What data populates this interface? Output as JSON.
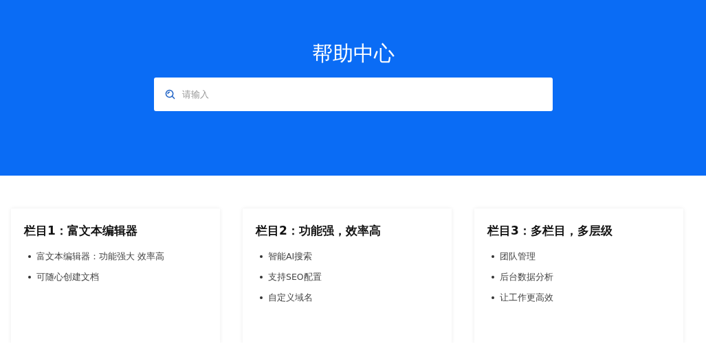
{
  "header": {
    "title": "帮助中心",
    "search": {
      "placeholder": "请输入"
    }
  },
  "columns": [
    {
      "title": "栏目1：富文本编辑器",
      "items": [
        "富文本编辑器：功能强大 效率高",
        "可随心创建文档"
      ]
    },
    {
      "title": "栏目2：功能强，效率高",
      "items": [
        "智能AI搜索",
        "支持SEO配置",
        "自定义域名"
      ]
    },
    {
      "title": "栏目3：多栏目，多层级",
      "items": [
        "团队管理",
        "后台数据分析",
        "让工作更高效"
      ]
    }
  ]
}
